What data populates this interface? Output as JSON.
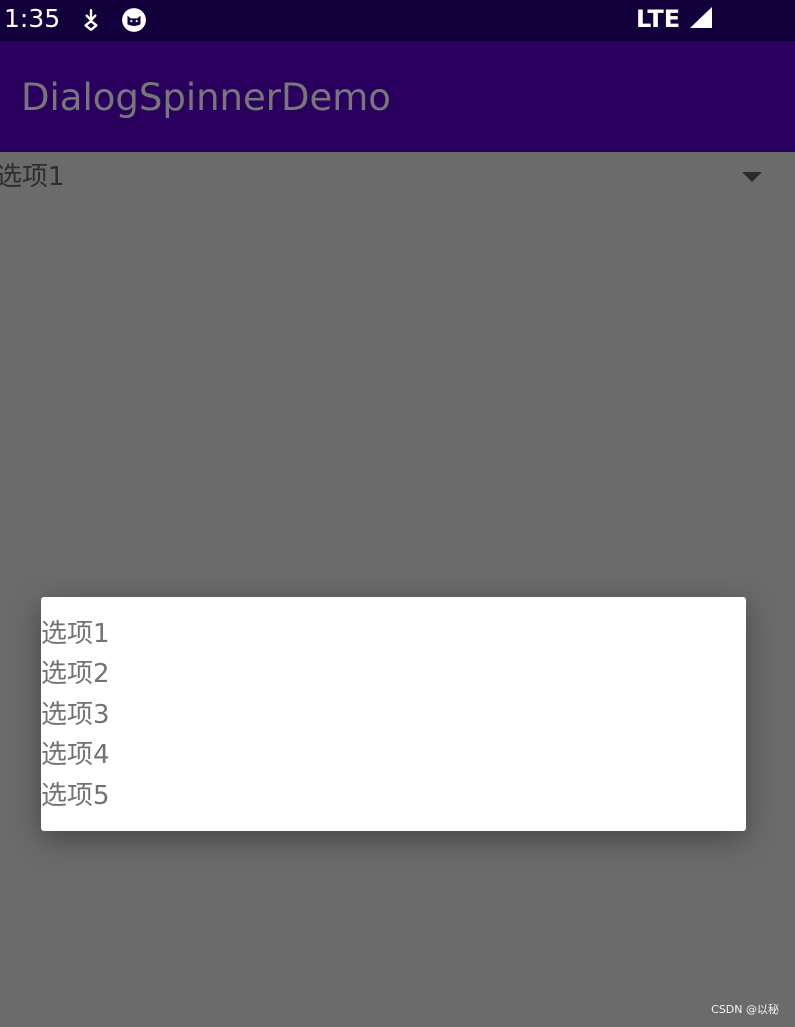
{
  "status_bar": {
    "time": "1:35",
    "network": "LTE",
    "icons": [
      "download-icon",
      "cat-icon",
      "signal-icon"
    ]
  },
  "app_bar": {
    "title": "DialogSpinnerDemo"
  },
  "spinner": {
    "selected": "选项1",
    "icon": "dropdown-arrow-icon"
  },
  "dialog": {
    "options": [
      "选项1",
      "选项2",
      "选项3",
      "选项4",
      "选项5"
    ]
  },
  "watermark": "CSDN @以秘",
  "colors": {
    "status_bar": "#12003a",
    "app_bar": "#2a005e",
    "scrim": "#6b6b6b",
    "dialog": "#ffffff"
  }
}
